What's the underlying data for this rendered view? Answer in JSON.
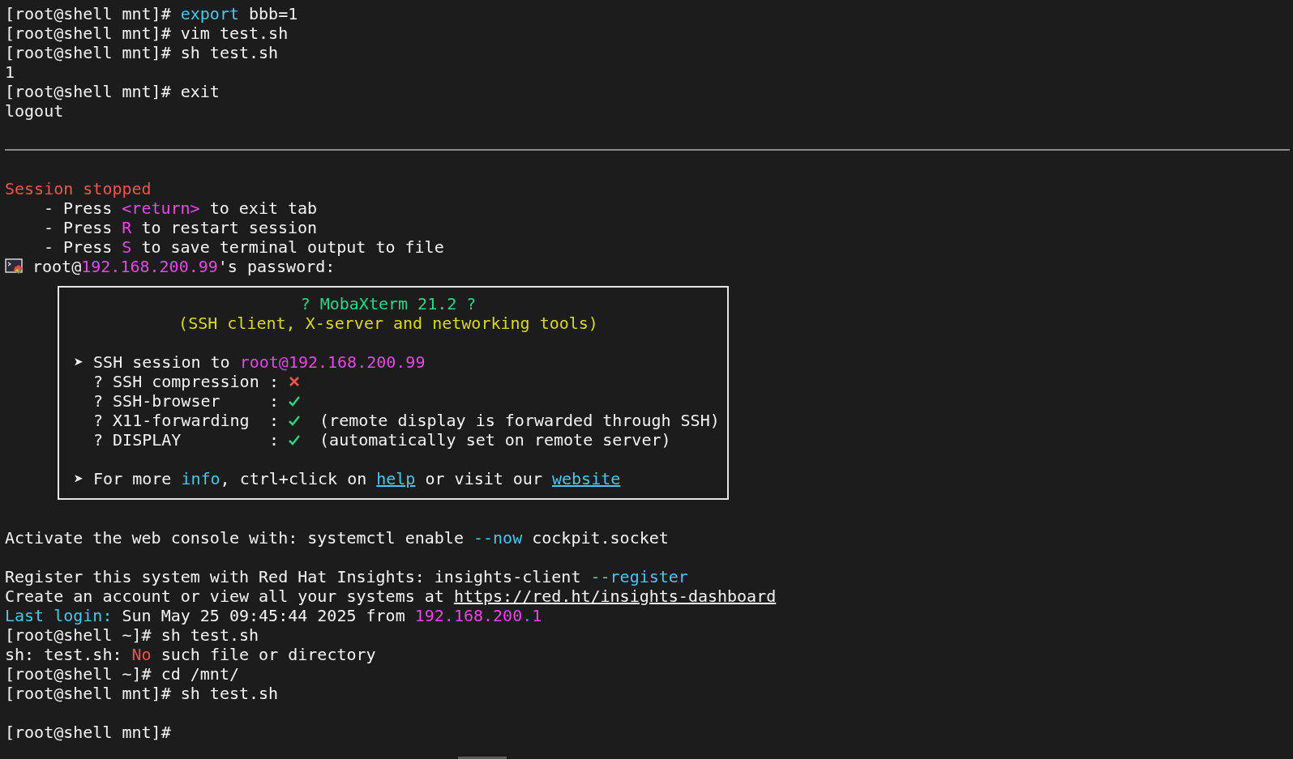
{
  "terminal": {
    "lines": [
      {
        "kind": "text",
        "segments": [
          {
            "text": "[root@shell mnt]# ",
            "kind": "plain"
          },
          {
            "text": "export",
            "kind": "keyword"
          },
          {
            "text": " bbb=1",
            "kind": "plain"
          }
        ]
      },
      {
        "kind": "text",
        "segments": [
          {
            "text": "[root@shell mnt]# vim test.sh",
            "kind": "plain"
          }
        ]
      },
      {
        "kind": "text",
        "segments": [
          {
            "text": "[root@shell mnt]# sh test.sh",
            "kind": "plain"
          }
        ]
      },
      {
        "kind": "text",
        "segments": [
          {
            "text": "1",
            "kind": "plain"
          }
        ]
      },
      {
        "kind": "text",
        "segments": [
          {
            "text": "[root@shell mnt]# exit",
            "kind": "plain"
          }
        ]
      },
      {
        "kind": "text",
        "segments": [
          {
            "text": "logout",
            "kind": "plain"
          }
        ]
      },
      {
        "kind": "blank"
      },
      {
        "kind": "separator"
      },
      {
        "kind": "blank"
      },
      {
        "kind": "text",
        "segments": [
          {
            "text": "Session stopped",
            "kind": "error"
          }
        ]
      },
      {
        "kind": "text",
        "indent": true,
        "segments": [
          {
            "text": "- Press ",
            "kind": "plain"
          },
          {
            "text": "<return>",
            "kind": "accent"
          },
          {
            "text": " to exit tab",
            "kind": "plain"
          }
        ]
      },
      {
        "kind": "text",
        "indent": true,
        "segments": [
          {
            "text": "- Press ",
            "kind": "plain"
          },
          {
            "text": "R",
            "kind": "accent"
          },
          {
            "text": " to restart session",
            "kind": "plain"
          }
        ]
      },
      {
        "kind": "text",
        "indent": true,
        "segments": [
          {
            "text": "- Press ",
            "kind": "plain"
          },
          {
            "text": "S",
            "kind": "accent"
          },
          {
            "text": " to save terminal output to file",
            "kind": "plain"
          }
        ]
      },
      {
        "kind": "icon-text",
        "segments": [
          {
            "text": "root@",
            "kind": "plain"
          },
          {
            "text": "192.168.200.99",
            "kind": "accent"
          },
          {
            "text": "'s password:",
            "kind": "plain"
          }
        ]
      },
      {
        "kind": "banner",
        "title": "? MobaXterm 21.2 ?",
        "subtitle": "(SSH client, X-server and networking tools)",
        "session": {
          "bullet": "➤",
          "segments": [
            {
              "text": "SSH session to ",
              "kind": "plain"
            },
            {
              "text": "root@192.168.200.99",
              "kind": "accent"
            }
          ]
        },
        "options": [
          {
            "label": "? SSH compression",
            "sep": ":",
            "enabled": false
          },
          {
            "label": "? SSH-browser",
            "sep": ":",
            "enabled": true
          },
          {
            "label": "? X11-forwarding",
            "sep": ":",
            "enabled": true,
            "note": "(remote display is forwarded through SSH)"
          },
          {
            "label": "? DISPLAY",
            "sep": ":",
            "enabled": true,
            "note": "(automatically set on remote server)"
          }
        ],
        "footer": {
          "bullet": "➤",
          "segments": [
            {
              "text": "For more ",
              "kind": "plain"
            },
            {
              "text": "info",
              "kind": "keyword"
            },
            {
              "text": ", ctrl+click on ",
              "kind": "plain"
            },
            {
              "text": "help",
              "kind": "link"
            },
            {
              "text": " or visit our ",
              "kind": "plain"
            },
            {
              "text": "website",
              "kind": "link"
            }
          ]
        }
      },
      {
        "kind": "text",
        "segments": [
          {
            "text": "Activate the web console with: systemctl enable ",
            "kind": "plain"
          },
          {
            "text": "--now",
            "kind": "keyword"
          },
          {
            "text": " cockpit.socket",
            "kind": "plain"
          }
        ]
      },
      {
        "kind": "blank"
      },
      {
        "kind": "text",
        "segments": [
          {
            "text": "Register this system with Red Hat Insights: insights-client ",
            "kind": "plain"
          },
          {
            "text": "--register",
            "kind": "keyword"
          }
        ]
      },
      {
        "kind": "text",
        "segments": [
          {
            "text": "Create an account or view all your systems at ",
            "kind": "plain"
          },
          {
            "text": "https://red.ht/insights-dashboard",
            "kind": "url"
          }
        ]
      },
      {
        "kind": "text",
        "segments": [
          {
            "text": "Last login:",
            "kind": "keyword"
          },
          {
            "text": " Sun May 25 09:45:44 2025 from ",
            "kind": "plain"
          },
          {
            "text": "192.168.200.1",
            "kind": "accent"
          }
        ]
      },
      {
        "kind": "text",
        "segments": [
          {
            "text": "[root@shell ~]# sh test.sh",
            "kind": "plain"
          }
        ]
      },
      {
        "kind": "text",
        "segments": [
          {
            "text": "sh: test.sh: ",
            "kind": "plain"
          },
          {
            "text": "No",
            "kind": "error"
          },
          {
            "text": " such file or directory",
            "kind": "plain"
          }
        ]
      },
      {
        "kind": "text",
        "segments": [
          {
            "text": "[root@shell ~]# cd /mnt/",
            "kind": "plain"
          }
        ]
      },
      {
        "kind": "text",
        "segments": [
          {
            "text": "[root@shell mnt]# sh test.sh",
            "kind": "plain"
          }
        ]
      },
      {
        "kind": "blank"
      },
      {
        "kind": "text",
        "segments": [
          {
            "text": "[root@shell mnt]#",
            "kind": "plain"
          }
        ]
      }
    ]
  }
}
